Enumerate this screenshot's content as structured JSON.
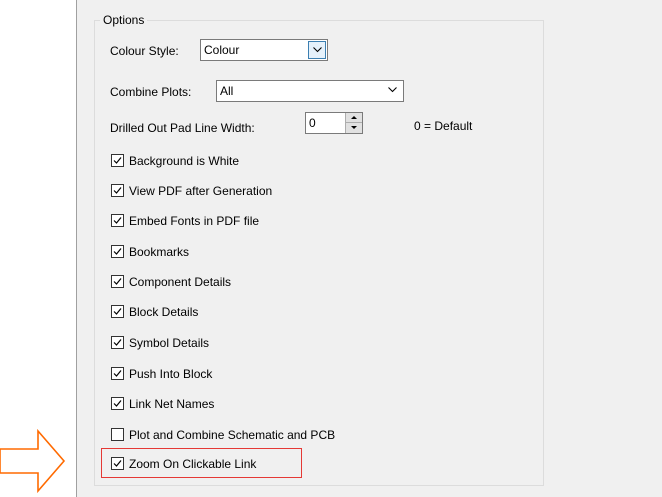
{
  "options_group": {
    "title": "Options"
  },
  "colour_style": {
    "label": "Colour Style:",
    "value": "Colour"
  },
  "combine_plots": {
    "label": "Combine Plots:",
    "value": "All"
  },
  "pad_line_width": {
    "label": "Drilled Out Pad Line Width:",
    "value": "0",
    "hint": "0 = Default"
  },
  "checkboxes": [
    {
      "label": "Background is White",
      "checked": true
    },
    {
      "label": "View PDF after Generation",
      "checked": true
    },
    {
      "label": "Embed Fonts in PDF file",
      "checked": true
    },
    {
      "label": "Bookmarks",
      "checked": true
    },
    {
      "label": "Component Details",
      "checked": true
    },
    {
      "label": "Block Details",
      "checked": true
    },
    {
      "label": "Symbol Details",
      "checked": true
    },
    {
      "label": "Push Into Block",
      "checked": true
    },
    {
      "label": "Link Net Names",
      "checked": true
    },
    {
      "label": "Plot and Combine Schematic and PCB",
      "checked": false
    },
    {
      "label": "Zoom On Clickable Link",
      "checked": true
    }
  ],
  "annotation": {
    "highlight_color": "#e53935",
    "arrow_color": "#ff6a00"
  }
}
